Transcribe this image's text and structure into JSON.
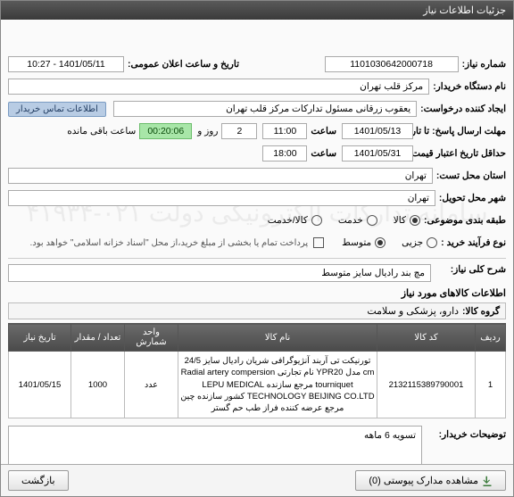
{
  "title": "جزئیات اطلاعات نیاز",
  "labels": {
    "need_no": "شماره نیاز:",
    "datetime_public": "تاریخ و ساعت اعلان عمومی:",
    "buyer_org": "نام دستگاه خریدار:",
    "creator": "ایجاد کننده درخواست:",
    "contact_info_btn": "اطلاعات تماس خریدار",
    "reply_deadline": "مهلت ارسال پاسخ: تا تاریخ:",
    "hour": "ساعت",
    "day": "روز و",
    "remain_suffix": "ساعت باقی مانده",
    "min_validity": "حداقل تاریخ اعتبار قیمت: تا تاریخ:",
    "test_city": "استان محل تست:",
    "delivery_city": "شهر محل تحویل:",
    "classification": "طبقه بندی موضوعی:",
    "goods": "کالا",
    "service": "خدمت",
    "goods_service": "کالا/خدمت",
    "process_type": "نوع فرآیند خرید :",
    "small": "جزیی",
    "medium": "متوسط",
    "payment_note": "پرداخت تمام یا بخشی از مبلغ خرید،از محل \"اسناد خزانه اسلامی\" خواهد بود.",
    "general_desc": "شرح کلی نیاز:",
    "items_header": "اطلاعات کالاهای مورد نیاز",
    "goods_group": "گروه کالا:",
    "buyer_notes": "توضیحات خریدار:",
    "attachments_btn": "مشاهده مدارک پیوستی (0)",
    "back_btn": "بازگشت"
  },
  "values": {
    "need_no": "1101030642000718",
    "datetime_public": "1401/05/11 - 10:27",
    "buyer_org": "مرکز قلب تهران",
    "creator": "یعقوب زرقانی مسئول تدارکات مرکز قلب تهران",
    "reply_date": "1401/05/13",
    "reply_hour": "11:00",
    "reply_days": "2",
    "countdown": "00:20:06",
    "validity_date": "1401/05/31",
    "validity_hour": "18:00",
    "test_city": "تهران",
    "delivery_city": "تهران",
    "general_desc": "مچ بند رادیال سایز متوسط",
    "goods_group": "دارو، پزشکی و سلامت",
    "buyer_notes": "تسویه 6 ماهه"
  },
  "table": {
    "headers": [
      "ردیف",
      "کد کالا",
      "نام کالا",
      "واحد شمارش",
      "تعداد / مقدار",
      "تاریخ نیاز"
    ],
    "rows": [
      {
        "idx": "1",
        "code": "2132115389790001",
        "name": "تورنیکت تی آربند آنژیوگرافی شریان رادیال سایز 24/5 cm مدل YPR20 نام تجارتی Radial artery compersion tourniquet مرجع سازنده LEPU MEDICAL TECHNOLOGY BEIJING CO.LTD کشور سازنده چین مرجع عرضه کننده فراز طب حم گستر",
        "unit": "عدد",
        "qty": "1000",
        "date": "1401/05/15"
      }
    ]
  },
  "watermark": "سامانه تدارکات الکترونیکی دولت ۰۲۱-۴۱۹۳۴"
}
